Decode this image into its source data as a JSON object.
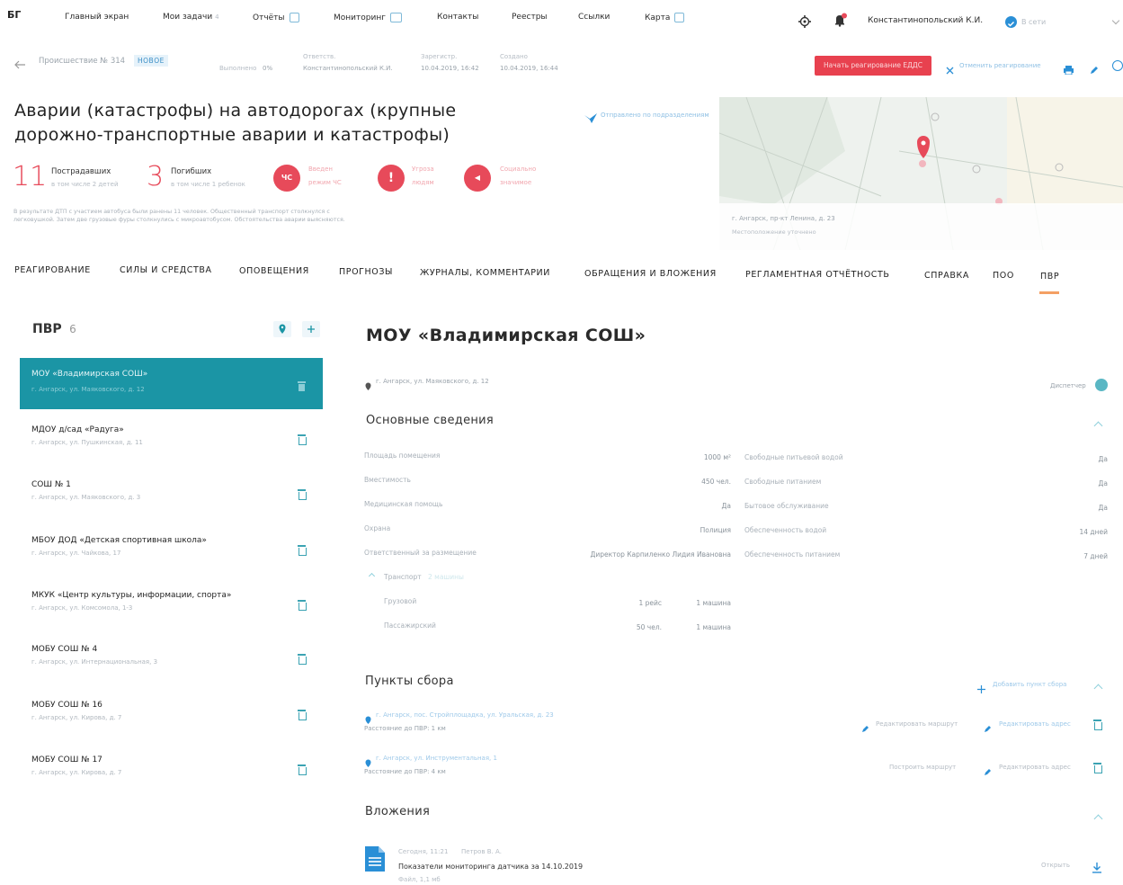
{
  "topbar": {
    "logo": "БГ",
    "nav": [
      {
        "label": "Главный экран",
        "icon": ""
      },
      {
        "label": "Мои задачи",
        "icon": "4",
        "badge": "4"
      },
      {
        "label": "Отчёты",
        "icon": "document-icon"
      },
      {
        "label": "Мониторинг",
        "icon": "monitor-icon"
      },
      {
        "label": "Контакты",
        "icon": ""
      },
      {
        "label": "Реестры",
        "icon": ""
      },
      {
        "label": "Ссылки",
        "icon": ""
      },
      {
        "label": "Карта",
        "icon": "external-link-icon"
      }
    ],
    "user_name": "Константинопольский К.И.",
    "status": "В сети",
    "colors": {
      "accent": "#1b95a5",
      "danger": "#e74a5a",
      "primary_btn": "#e8414f"
    }
  },
  "incident_bar": {
    "back_label": "Происшествие № 314",
    "status_tag": "НОВОЕ",
    "progress_label": "Выполнено",
    "progress_value": "0%",
    "responsible_label": "Ответств.",
    "responsible_value": "Константинопольский К.И.",
    "registered_label": "Зарегистр.",
    "registered_value": "10.04.2019, 16:42",
    "created_label": "Создано",
    "created_value": "10.04.2019, 16:44",
    "primary_button": "Начать реагирование ЕДДС",
    "cancel_link": "Отменить реагирование"
  },
  "incident": {
    "title_line1": "Аварии (катастрофы) на автодорогах (крупные",
    "title_line2": "дорожно-транспортные аварии и катастрофы)",
    "send_link": "Отправлено по подразделениям",
    "stats": [
      {
        "number": "11",
        "label": "Пострадавших",
        "sub": "в том числе 2 детей"
      },
      {
        "number": "3",
        "label": "Погибших",
        "sub": "в том числе 1 ребенок"
      }
    ],
    "badges": [
      {
        "icon_text": "ЧС",
        "line1": "Введен",
        "line2": "режим ЧС"
      },
      {
        "icon_text": "!",
        "line1": "Угроза",
        "line2": "людям"
      },
      {
        "icon_text": "◀",
        "line1": "Социально",
        "line2": "значимое"
      }
    ],
    "description_line1": "В результате ДТП с участием автобуса были ранены 11 человек. Общественный транспорт столкнулся с",
    "description_line2": "легковушкой. Затем две грузовые фуры столкнулись с микроавтобусом. Обстоятельства аварии выясняются."
  },
  "map": {
    "address": "г. Ангарск, пр-кт Ленина, д. 23",
    "sub": "Местоположение уточнено"
  },
  "tabs": [
    "РЕАГИРОВАНИЕ",
    "СИЛЫ И СРЕДСТВА",
    "ОПОВЕЩЕНИЯ",
    "ПРОГНОЗЫ",
    "ЖУРНАЛЫ, КОММЕНТАРИИ",
    "ОБРАЩЕНИЯ И ВЛОЖЕНИЯ",
    "РЕГЛАМЕНТНАЯ ОТЧЁТНОСТЬ",
    "СПРАВКА",
    "ПОО",
    "ПВР"
  ],
  "pvr_panel": {
    "title": "ПВР",
    "count": "6",
    "items": [
      {
        "name": "МОУ «Владимирская СОШ»",
        "address": "г. Ангарск, ул. Маяковского, д. 12"
      },
      {
        "name": "МДОУ д/сад «Радуга»",
        "address": "г. Ангарск, ул. Пушкинская, д. 11"
      },
      {
        "name": "СОШ № 1",
        "address": "г. Ангарск, ул. Маяковского, д. 3"
      },
      {
        "name": "МБОУ ДОД «Детская спортивная школа»",
        "address": "г. Ангарск, ул. Чайкова, 17"
      },
      {
        "name": "МКУК «Центр культуры, информации, спорта»",
        "address": "г. Ангарск, ул. Комсомола, 1-3"
      },
      {
        "name": "МОБУ СОШ № 4",
        "address": "г. Ангарск, ул. Интернациональная, 3"
      },
      {
        "name": "МОБУ СОШ № 16",
        "address": "г. Ангарск, ул. Кирова, д. 7"
      },
      {
        "name": "МОБУ СОШ № 17",
        "address": "г. Ангарск, ул. Кирова, д. 7"
      }
    ]
  },
  "detail": {
    "title": "МОУ «Владимирская СОШ»",
    "address": "г. Ангарск, ул. Маяковского, д. 12",
    "dispatcher_label": "Диспетчер",
    "basic_info_title": "Основные сведения",
    "left_rows": [
      {
        "label": "Площадь помещения",
        "value": "1000 м²"
      },
      {
        "label": "Вместимость",
        "value": "450 чел."
      },
      {
        "label": "Медицинская помощь",
        "value": "Да"
      },
      {
        "label": "Охрана",
        "value": "Полиция"
      },
      {
        "label": "Ответственный за размещение",
        "value": "Директор Карпиленко Лидия Ивановна"
      }
    ],
    "right_rows": [
      {
        "label": "Свободные питьевой водой",
        "value": "Да"
      },
      {
        "label": "Свободные питанием",
        "value": "Да"
      },
      {
        "label": "Бытовое обслуживание",
        "value": "Да"
      },
      {
        "label": "Обеспеченность водой",
        "value": "14 дней"
      },
      {
        "label": "Обеспеченность питанием",
        "value": "7 дней"
      }
    ],
    "transport_label": "Транспорт",
    "transport_sub": "2 машины",
    "transport_rows": [
      {
        "label": "Грузовой",
        "value": "1 рейс",
        "count": "1 машина"
      },
      {
        "label": "Пассажирский",
        "value": "50 чел.",
        "count": "1 машина"
      }
    ],
    "assembly_title": "Пункты сбора",
    "assembly_add": "Добавить пункт сбора",
    "assembly_points": [
      {
        "address": "г. Ангарск, пос. Стройплощадка, ул. Уральская, д. 23",
        "distance": "Расстояние до ПВР: 1 км",
        "action1": "Редактировать маршрут",
        "action2": "Редактировать адрес"
      },
      {
        "address": "г. Ангарск, ул. Инструментальная, 1",
        "distance": "Расстояние до ПВР: 4 км",
        "action1": "Построить маршрут",
        "action2": "Редактировать адрес"
      }
    ],
    "attachments_title": "Вложения",
    "attachment": {
      "meta_time": "Сегодня, 11:21",
      "meta_author": "Петров В. А.",
      "name": "Показатели мониторинга датчика за 14.10.2019",
      "size": "Файл, 1,1 мб",
      "action": "Открыть"
    }
  }
}
